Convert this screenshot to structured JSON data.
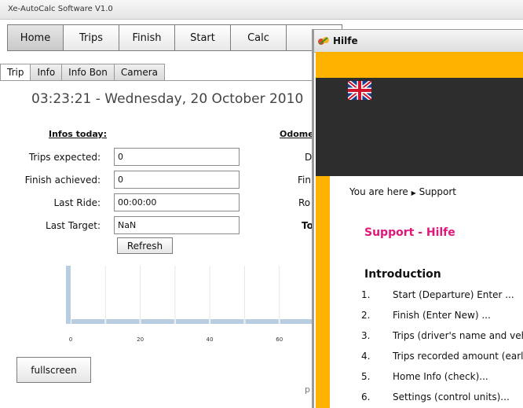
{
  "app": {
    "title": "Xe-AutoCalc Software V1.0"
  },
  "nav": {
    "items": [
      "Home",
      "Trips",
      "Finish",
      "Start",
      "Calc"
    ]
  },
  "tabs": [
    "Trip",
    "Info",
    "Info Bon",
    "Camera"
  ],
  "datetime": "03:23:21 - Wednesday, 20 October 2010",
  "infos": {
    "title": "Infos today:",
    "rows": [
      {
        "label": "Trips expected:",
        "value": "0"
      },
      {
        "label": "Finish achieved:",
        "value": "0"
      },
      {
        "label": "Last Ride:",
        "value": "00:00:00"
      },
      {
        "label": "Last Target:",
        "value": "NaN"
      }
    ],
    "refresh": "Refresh"
  },
  "odometer": {
    "title_fragment": "Odome",
    "labels": [
      "D",
      "Fin",
      "Ro",
      "To"
    ]
  },
  "chart_data": {
    "type": "bar",
    "x_ticks": [
      "0",
      "20",
      "40",
      "60"
    ],
    "values": [
      0,
      0,
      0,
      0,
      0,
      0,
      0
    ],
    "colors": {
      "bar": "#b8cde0"
    }
  },
  "fullscreen": "fullscreen",
  "footer_fragment": "p",
  "help": {
    "title": "Hilfe",
    "breadcrumb_prefix": "You are here",
    "breadcrumb_current": "Support",
    "heading": "Support - Hilfe",
    "intro": "Introduction",
    "items": [
      {
        "num": "1.",
        "text": "Start (Departure) Enter ..."
      },
      {
        "num": "2.",
        "text": "Finish (Enter New) ..."
      },
      {
        "num": "3.",
        "text": "Trips (driver's name and vehicl"
      },
      {
        "num": "4.",
        "text": "Trips recorded amount (early b"
      },
      {
        "num": "5.",
        "text": "Home Info (check)..."
      },
      {
        "num": "6.",
        "text": "Settings (control units)..."
      }
    ],
    "colors": {
      "accent": "#ffb300",
      "dark": "#2d2d2d",
      "heading": "#e0177a"
    }
  }
}
